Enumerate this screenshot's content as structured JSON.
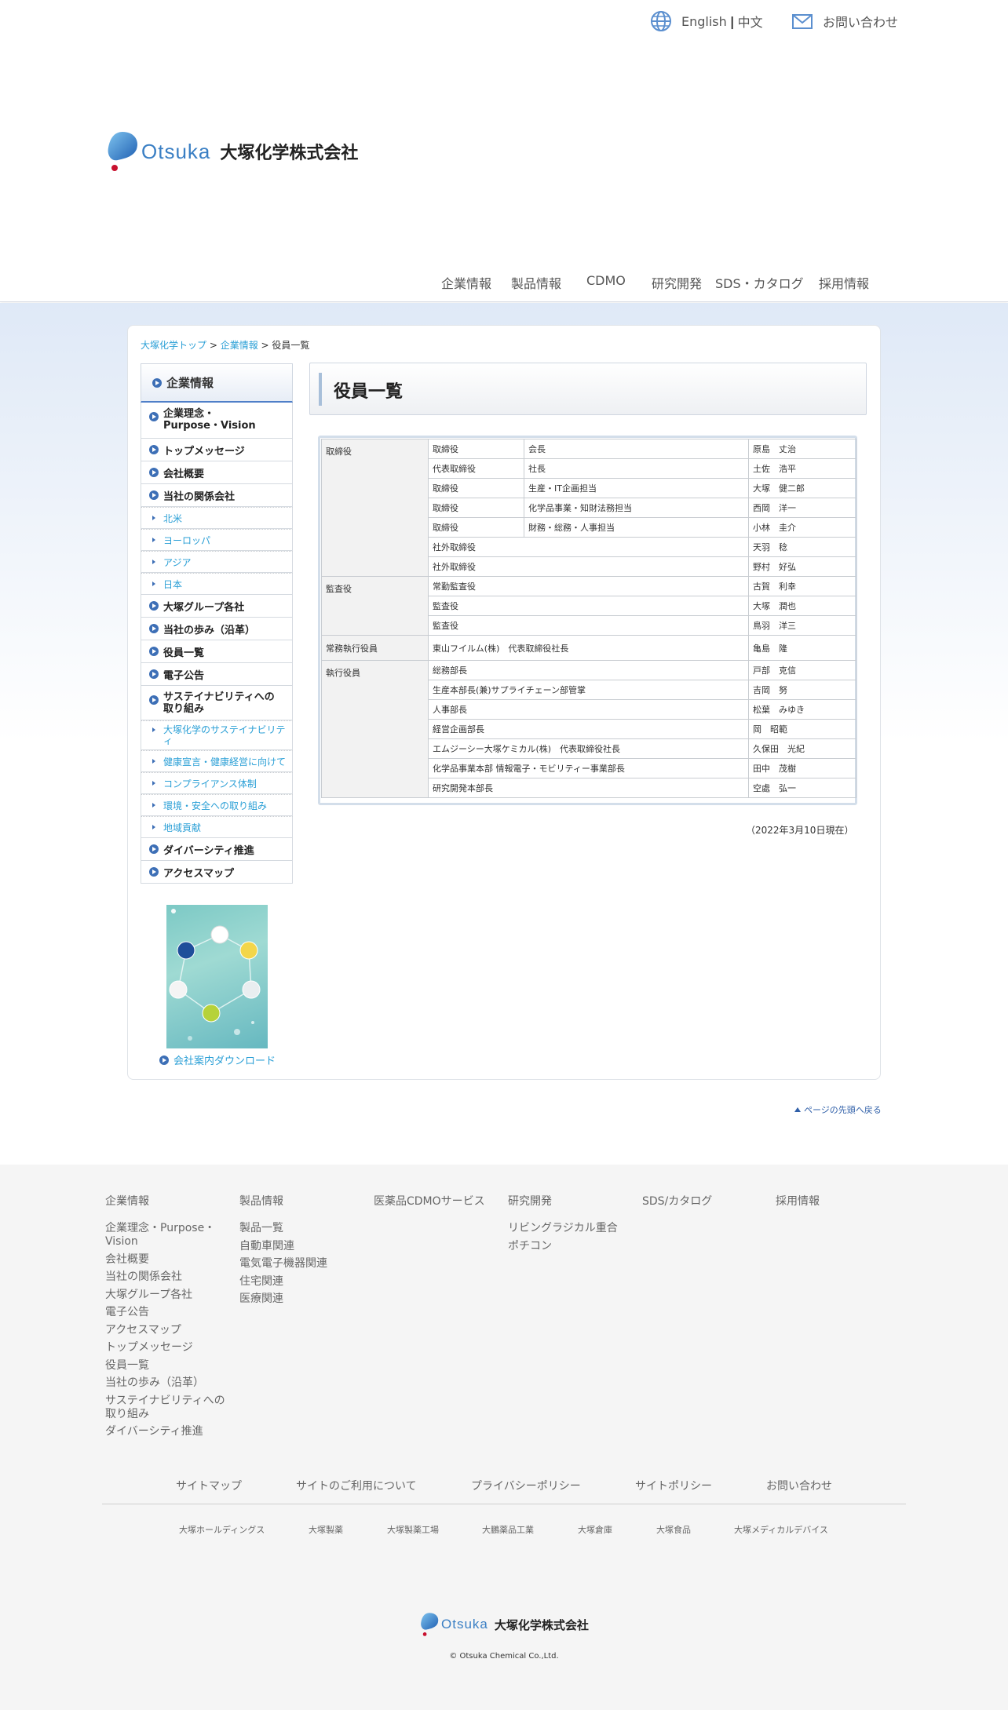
{
  "header": {
    "lang_english": "English",
    "lang_sep": "|",
    "lang_chinese": "中文",
    "contact_label": "お問い合わせ",
    "logo_text": "Otsuka",
    "logo_company": "大塚化学株式会社",
    "nav": [
      "企業情報",
      "製品情報",
      "CDMO",
      "研究開発",
      "SDS・カタログ",
      "採用情報"
    ]
  },
  "breadcrumb": {
    "home": "大塚化学トップ",
    "sep1": " > ",
    "section": "企業情報",
    "sep2": " > ",
    "current": "役員一覧"
  },
  "sidebar": {
    "heading": "企業情報",
    "items": [
      {
        "label": "企業理念・",
        "label2": "Purpose・Vision"
      },
      {
        "label": "トップメッセージ"
      },
      {
        "label": "会社概要"
      },
      {
        "label": "当社の関係会社"
      },
      {
        "sub": "北米"
      },
      {
        "sub": "ヨーロッパ"
      },
      {
        "sub": "アジア"
      },
      {
        "sub": "日本"
      },
      {
        "label": "大塚グループ各社"
      },
      {
        "label": "当社の歩み（沿革）"
      },
      {
        "label": "役員一覧"
      },
      {
        "label": "電子公告"
      },
      {
        "label": "サステイナビリティへの",
        "label2": "取り組み"
      },
      {
        "sub": "大塚化学のサステイナビリテ",
        "sub2": "ィ"
      },
      {
        "sub": "健康宣言・健康経営に向けて"
      },
      {
        "sub": "コンプライアンス体制"
      },
      {
        "sub": "環境・安全への取り組み"
      },
      {
        "sub": "地域貢献"
      },
      {
        "label": "ダイバーシティ推進"
      },
      {
        "label": "アクセスマップ"
      }
    ],
    "brochure_download": "会社案内ダウンロード"
  },
  "main": {
    "title": "役員一覧",
    "officers": [
      {
        "cat": "取締役",
        "position": "取締役",
        "role": "会長",
        "name": "原島　丈治"
      },
      {
        "position": "代表取締役",
        "role": "社長",
        "name": "土佐　浩平"
      },
      {
        "position": "取締役",
        "role": "生産・IT企画担当",
        "name": "大塚　健二郎"
      },
      {
        "position": "取締役",
        "role": "化学品事業・知財法務担当",
        "name": "西岡　洋一"
      },
      {
        "position": "取締役",
        "role": "財務・総務・人事担当",
        "name": "小林　圭介"
      },
      {
        "position": "社外取締役",
        "name": "天羽　稔"
      },
      {
        "position": "社外取締役",
        "name": "野村　好弘"
      },
      {
        "cat": "監査役",
        "position": "常勤監査役",
        "name": "古賀　利幸"
      },
      {
        "position": "監査役",
        "name": "大塚　潤也"
      },
      {
        "position": "監査役",
        "name": "鳥羽　洋三"
      },
      {
        "cat": "常務執行役員",
        "position": "東山フイルム(株)　代表取締役社長",
        "name": "亀島　隆"
      },
      {
        "cat": "執行役員",
        "position": "総務部長",
        "name": "戸部　克信"
      },
      {
        "position": "生産本部長(兼)サプライチェーン部管掌",
        "name": "吉岡　努"
      },
      {
        "position": "人事部長",
        "name": "松葉　みゆき"
      },
      {
        "position": "経営企画部長",
        "name": "岡　昭範"
      },
      {
        "position": "エムジーシー大塚ケミカル(株)　代表取締役社長",
        "name": "久保田　光紀"
      },
      {
        "position": "化学品事業本部 情報電子・モビリティー事業部長",
        "name": "田中　茂樹"
      },
      {
        "position": "研究開発本部長",
        "name": "空處　弘一"
      }
    ],
    "as_of": "（2022年3月10日現在）",
    "page_top": "ページの先頭へ戻る"
  },
  "footer": {
    "columns": [
      {
        "heading": "企業情報",
        "links": [
          "企業理念・Purpose・Vision",
          "会社概要",
          "当社の関係会社",
          "大塚グループ各社",
          "電子公告",
          "アクセスマップ",
          "トップメッセージ",
          "役員一覧",
          "当社の歩み（沿革）",
          "サステイナビリティへの取り組み",
          "ダイバーシティ推進"
        ]
      },
      {
        "heading": "製品情報",
        "links": [
          "製品一覧",
          "自動車関連",
          "電気電子機器関連",
          "住宅関連",
          "医療関連"
        ]
      },
      {
        "heading": "医薬品CDMOサービス",
        "links": []
      },
      {
        "heading": "研究開発",
        "links": [
          "リビングラジカル重合",
          "ポチコン"
        ]
      },
      {
        "heading": "SDS/カタログ",
        "links": []
      },
      {
        "heading": "採用情報",
        "links": []
      }
    ],
    "bar_links": [
      "サイトマップ",
      "サイトのご利用について",
      "プライバシーポリシー",
      "サイトポリシー",
      "お問い合わせ"
    ],
    "group_links": [
      "大塚ホールディングス",
      "大塚製薬",
      "大塚製薬工場",
      "大鵬薬品工業",
      "大塚倉庫",
      "大塚食品",
      "大塚メディカルデバイス"
    ],
    "logo_text": "Otsuka",
    "logo_company": "大塚化学株式会社",
    "copyright": "© Otsuka Chemical Co.,Ltd."
  },
  "colors": {
    "accent_link": "#2a9fd6",
    "nav_bullet": "#3d6fb6",
    "logo_blue": "#3a7fc4"
  }
}
